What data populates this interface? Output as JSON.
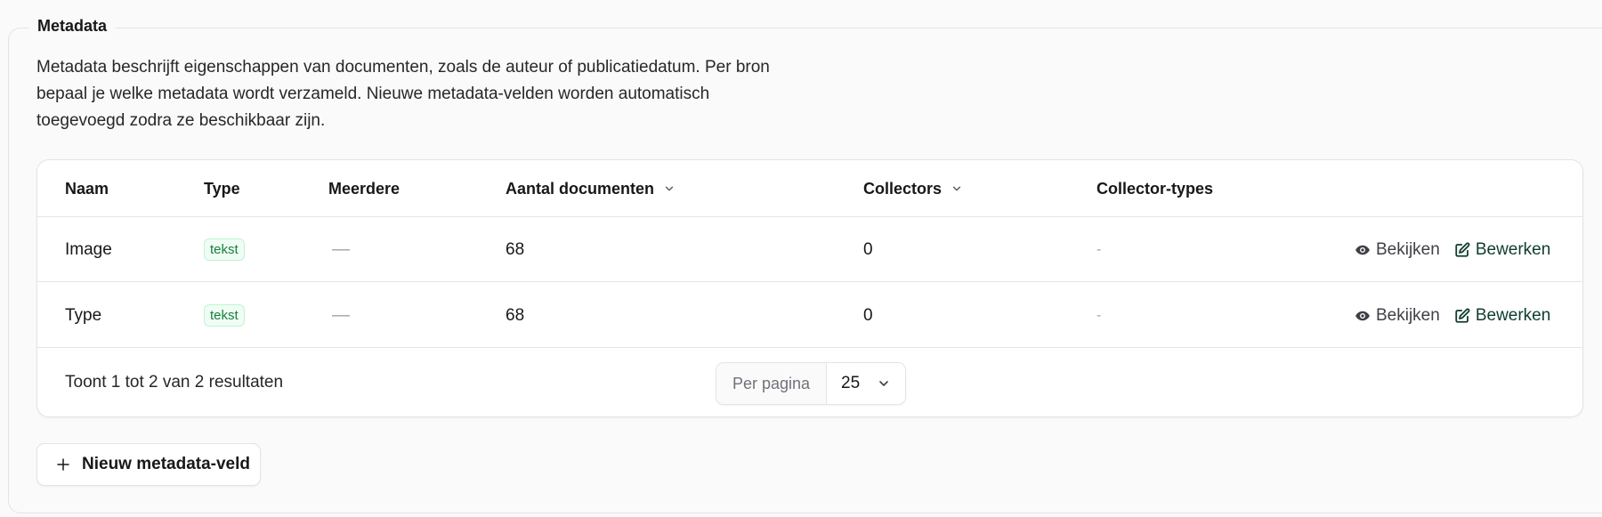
{
  "section": {
    "legend": "Metadata",
    "description": "Metadata beschrijft eigenschappen van documenten, zoals de auteur of publicatiedatum. Per bron bepaal je welke metadata wordt verzameld. Nieuwe metadata-velden worden automatisch toegevoegd zodra ze beschikbaar zijn."
  },
  "table": {
    "columns": {
      "naam": "Naam",
      "type": "Type",
      "meerdere": "Meerdere",
      "aantal": "Aantal documenten",
      "collectors": "Collectors",
      "collector_types": "Collector-types"
    },
    "sortable_icon": "chevron-down-icon",
    "rows": [
      {
        "naam": "Image",
        "type": "tekst",
        "meerdere": "—",
        "aantal": "68",
        "collectors": "0",
        "collector_types": "-",
        "view_label": "Bekijken",
        "edit_label": "Bewerken"
      },
      {
        "naam": "Type",
        "type": "tekst",
        "meerdere": "—",
        "aantal": "68",
        "collectors": "0",
        "collector_types": "-",
        "view_label": "Bekijken",
        "edit_label": "Bewerken"
      }
    ]
  },
  "pagination": {
    "results_text": "Toont 1 tot 2 van 2 resultaten",
    "per_page_label": "Per pagina",
    "per_page_value": "25"
  },
  "actions": {
    "new_field_label": "Nieuw metadata-veld"
  },
  "colors": {
    "badge_text": "#15803d",
    "badge_bg": "#f0fdf4",
    "edit_action": "#0f3d2e"
  }
}
